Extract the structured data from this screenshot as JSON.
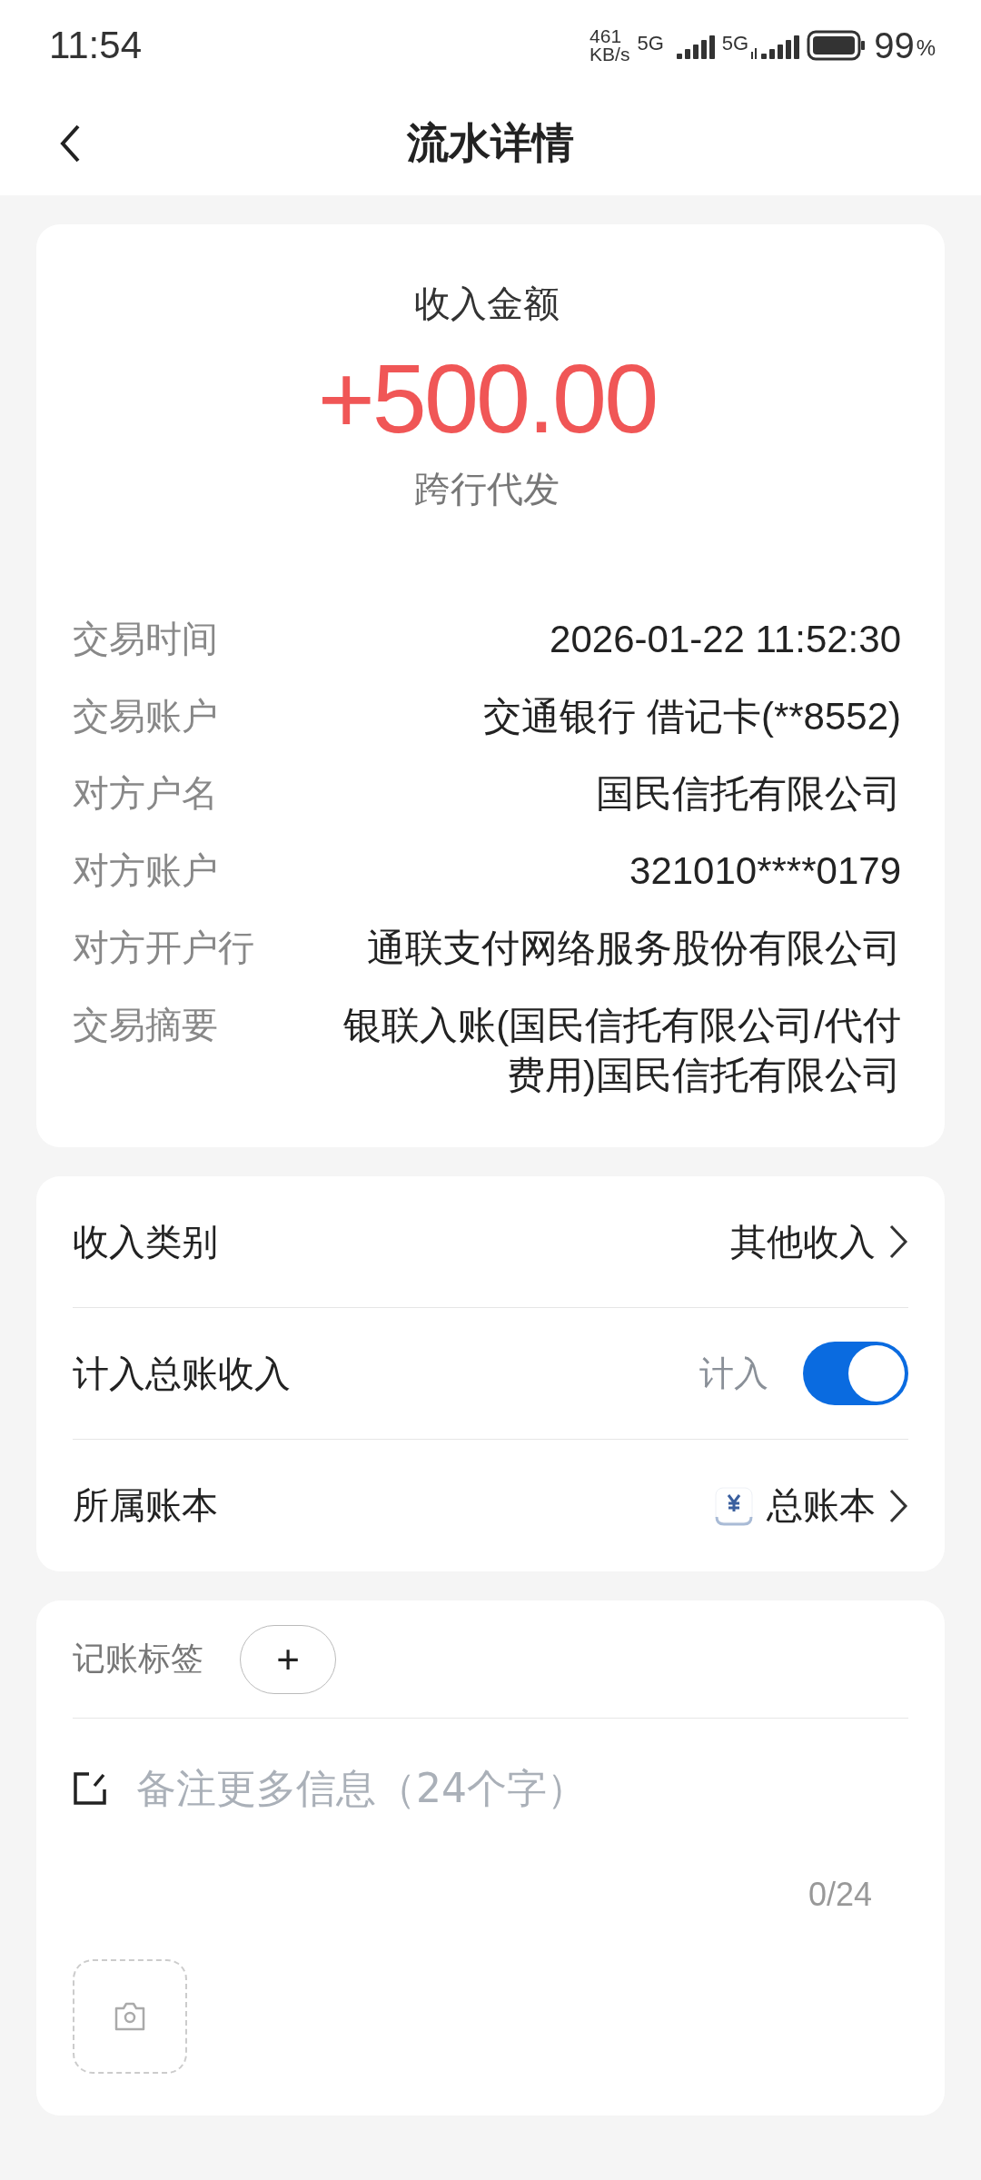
{
  "status_bar": {
    "time": "11:54",
    "speed_value": "461",
    "speed_unit": "KB/s",
    "networks": [
      "5G",
      "5G"
    ],
    "battery": "99",
    "battery_unit": "%"
  },
  "nav": {
    "title": "流水详情"
  },
  "summary": {
    "label": "收入金额",
    "amount": "+500.00",
    "type": "跨行代发"
  },
  "details": [
    {
      "label": "交易时间",
      "value": "2026-01-22 11:52:30"
    },
    {
      "label": "交易账户",
      "value": "交通银行 借记卡(**8552)"
    },
    {
      "label": "对方户名",
      "value": "国民信托有限公司"
    },
    {
      "label": "对方账户",
      "value": "321010****0179"
    },
    {
      "label": "对方开户行",
      "value": "通联支付网络服务股份有限公司"
    },
    {
      "label": "交易摘要",
      "value": "银联入账(国民信托有限公司/代付费用)国民信托有限公司"
    }
  ],
  "settings": [
    {
      "kind": "link",
      "label": "收入类别",
      "value": "其他收入"
    },
    {
      "kind": "toggle",
      "label": "计入总账收入",
      "value": "计入",
      "on": true
    },
    {
      "kind": "book",
      "label": "所属账本",
      "value": "总账本"
    }
  ],
  "notes": {
    "tag_label": "记账标签",
    "tag_add": "+",
    "placeholder": "备注更多信息（24个字）",
    "counter": "0/24"
  }
}
